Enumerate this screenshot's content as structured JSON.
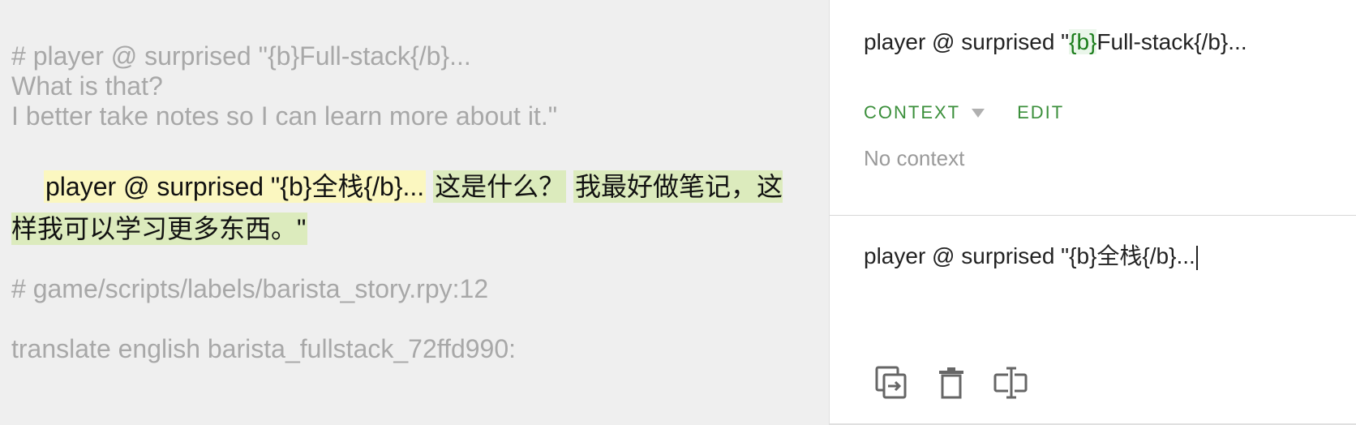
{
  "document": {
    "source_lines": [
      "# player @ surprised \"{b}Full-stack{/b}...",
      "What is that?",
      "I better take notes so I can learn more about it.\""
    ],
    "target_segments": [
      "player @ surprised \"{b}全栈{/b}...",
      "这是什么？",
      "我最好做笔记，这样我可以学习更多东西。\""
    ],
    "path_comment": "# game/scripts/labels/barista_story.rpy:12",
    "translate_line": "translate english barista_fullstack_72ffd990:"
  },
  "panel": {
    "source_prefix": "player @ surprised \"",
    "source_tag": "{b}",
    "source_rest": "Full-stack{/b}...",
    "tabs": {
      "context": "CONTEXT",
      "edit": "EDIT"
    },
    "no_context": "No context",
    "editor_value": "player @ surprised \"{b}全栈{/b}...",
    "tools": [
      "copy-icon",
      "trash-icon",
      "text-cursor-icon"
    ]
  },
  "colors": {
    "accent": "#3b8f3b",
    "highlight_yellow": "#fbf7c0",
    "highlight_green": "#dcebbd"
  }
}
